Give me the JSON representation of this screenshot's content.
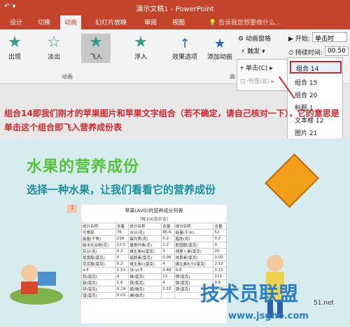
{
  "window": {
    "title": "演示文稿1 - PowerPoint"
  },
  "tabs": [
    "设计",
    "切换",
    "动画",
    "幻灯片放映",
    "审阅",
    "视图"
  ],
  "active_tab": "动画",
  "tellme": "告诉我您想要做什么...",
  "animations": [
    {
      "label": "出现"
    },
    {
      "label": "淡出"
    },
    {
      "label": "飞入"
    },
    {
      "label": "浮入"
    }
  ],
  "effect_options": "效果选项",
  "group_animation": "动画",
  "add_animation": "添加动画",
  "group_advanced": "高",
  "animation_pane": "动画窗格",
  "trigger": "触发",
  "start_label": "开始:",
  "start_value": "单击时",
  "duration_label": "持续时间:",
  "duration_value": "00.50",
  "trigger_menu": {
    "click": "单击(C)",
    "bookmark": "书签(B)"
  },
  "objects": [
    "组合 14",
    "组合 15",
    "组合 20",
    "标题 1",
    "文本框 12",
    "图片 21"
  ],
  "note": "组合14即我们刚才的苹果图片和苹果文字组合（若不确定，请自己核对一下），它的意思是单击这个组合即飞入营养成份表",
  "slide": {
    "heading1": "水果的营养成份",
    "heading2": "选择一种水果，让我们看看它的营养成份",
    "badge": "1",
    "table_title": "苹果(AVG)的营养成分列表",
    "table_sub": "(每100克中含)",
    "rows": [
      [
        "成分名称",
        "含量",
        "成分名称",
        "含量",
        "成分名称",
        "含量"
      ],
      [
        "可食部",
        "76",
        "水分(克)",
        "85.9",
        "能量(千卡)",
        "52"
      ],
      [
        "能量(千焦)",
        "218",
        "蛋白质(克)",
        "0.2",
        "脂肪(克)",
        "0.2"
      ],
      [
        "碳水化合物(克)",
        "13.5",
        "膳食纤维(克)",
        "1.2",
        "胆固醇(毫克)",
        "0"
      ],
      [
        "灰分(克)",
        "0.2",
        "维生素A(毫克)",
        "3",
        "胡萝卜素(毫克)",
        "20"
      ],
      [
        "视黄醇(毫克)",
        "0",
        "硫胺素(毫克)",
        "0.06",
        "核黄素(毫克)",
        "0.02"
      ],
      [
        "尼克酸(毫克)",
        "0.2",
        "维生素C(毫克)",
        "4",
        "维生素E(T)(毫克)",
        "2.12"
      ],
      [
        "a-E",
        "1.53",
        "(β-γ)-E",
        "0.48",
        "δ-E",
        "0.11"
      ],
      [
        "钙(毫克)",
        "4",
        "磷(毫克)",
        "12",
        "钾(毫克)",
        "119"
      ],
      [
        "钠(毫克)",
        "1.6",
        "镁(毫克)",
        "4",
        "铁(毫克)",
        "0.6"
      ],
      [
        "锌(毫克)",
        "0.19",
        "硒(微克)",
        "0.12",
        "铜(毫克)",
        "0.06"
      ],
      [
        "锰(毫克)",
        "0.03",
        "碘(微克)",
        "",
        "",
        " "
      ]
    ]
  },
  "watermark": {
    "main": "技术员联盟",
    "url": "www.jsgho.com",
    "side": "51.net"
  }
}
